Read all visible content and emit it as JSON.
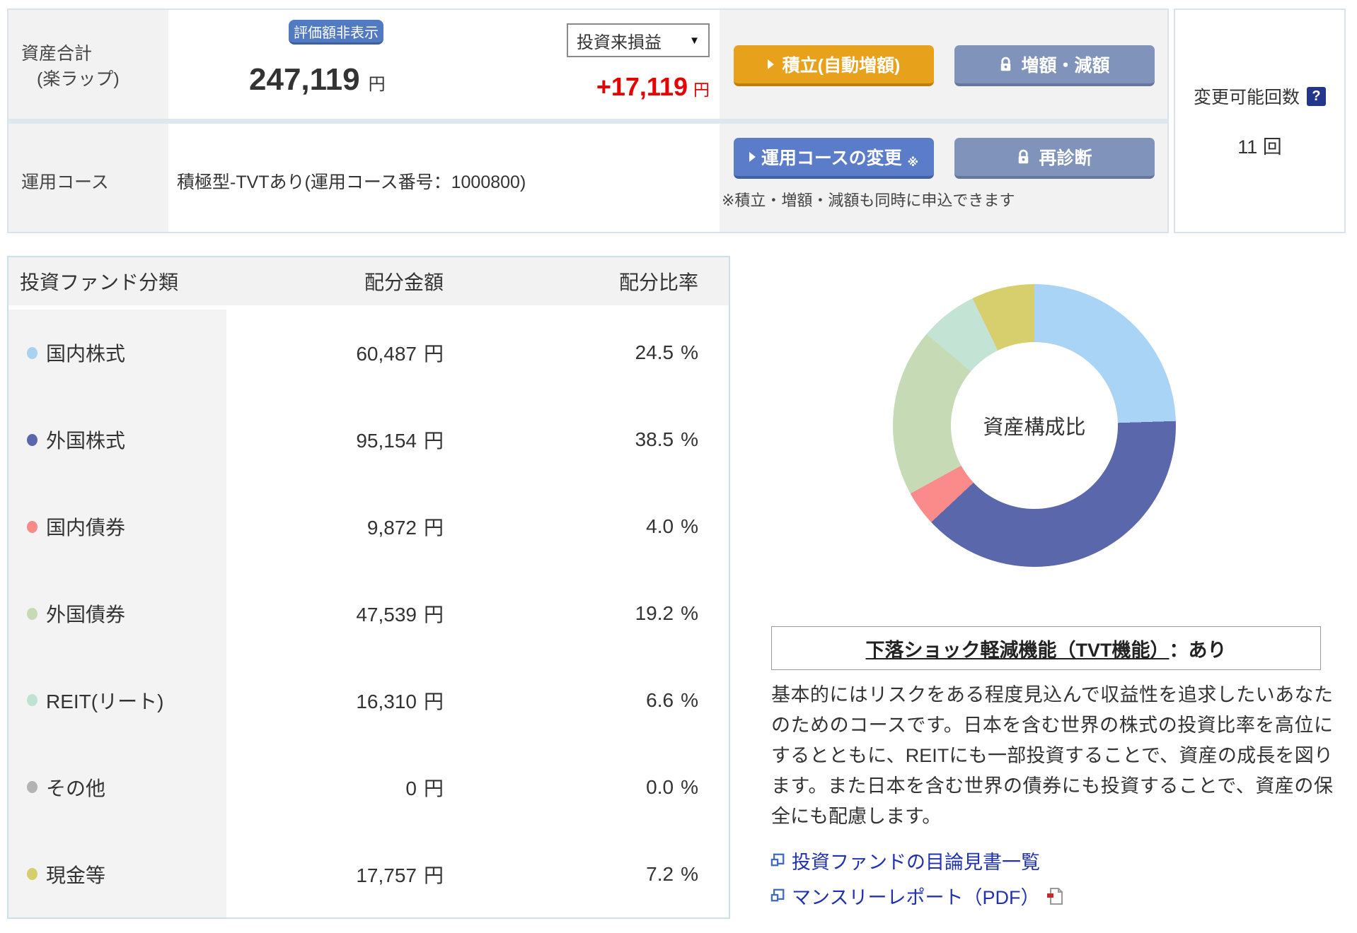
{
  "header": {
    "asset_total": {
      "label_line1": "資産合計",
      "label_line2": "(楽ラップ)",
      "hide_button": "評価額非表示",
      "amount": "247,119",
      "amount_unit": "円"
    },
    "profit": {
      "dropdown_value": "投資来損益",
      "value": "+17,119",
      "unit": "円"
    },
    "course": {
      "label": "運用コース",
      "value": "積極型-TVTあり(運用コース番号：1000800)"
    },
    "buttons": {
      "tsumitate": "積立(自動増額)",
      "zogaku_gengaku": "増額・減額",
      "course_change": "運用コースの変更",
      "course_change_mark": "※",
      "rediagnosis": "再診断"
    },
    "note": "※積立・増額・減額も同時に申込できます",
    "change_count": {
      "label": "変更可能回数",
      "help": "?",
      "value": "11",
      "unit": "回"
    }
  },
  "icons": {
    "caret_down": "▼"
  },
  "alloc_table": {
    "headers": [
      "投資ファンド分類",
      "配分金額",
      "配分比率"
    ],
    "amount_unit": "円",
    "ratio_unit": "%",
    "rows": [
      {
        "label": "国内株式",
        "color": "#a8d2f0",
        "amount": "60,487",
        "ratio": "24.5"
      },
      {
        "label": "外国株式",
        "color": "#5a67ab",
        "amount": "95,154",
        "ratio": "38.5"
      },
      {
        "label": "国内債券",
        "color": "#f88a8a",
        "amount": "9,872",
        "ratio": "4.0"
      },
      {
        "label": "外国債券",
        "color": "#c7dab6",
        "amount": "47,539",
        "ratio": "19.2"
      },
      {
        "label": "REIT(リート)",
        "color": "#bfe2d2",
        "amount": "16,310",
        "ratio": "6.6"
      },
      {
        "label": "その他",
        "color": "#b3b3b3",
        "amount": "0",
        "ratio": "0.0"
      },
      {
        "label": "現金等",
        "color": "#d6ce6c",
        "amount": "17,757",
        "ratio": "7.2"
      }
    ]
  },
  "chart_data": {
    "type": "pie",
    "title": "資産構成比",
    "categories": [
      "国内株式",
      "外国株式",
      "国内債券",
      "外国債券",
      "REIT(リート)",
      "その他",
      "現金等"
    ],
    "values": [
      24.5,
      38.5,
      4.0,
      19.2,
      6.6,
      0.0,
      7.2
    ],
    "colors": [
      "#a9d4f5",
      "#5a67ab",
      "#fb8b8b",
      "#c7dab6",
      "#c3e3d4",
      "#b3b3b3",
      "#d7cf6d"
    ],
    "unit": "%",
    "center_label": "資産構成比",
    "donut_inner_ratio": 0.59,
    "start_angle_deg": 0,
    "direction": "clockwise",
    "legend_position": "none"
  },
  "course_info": {
    "tvt_title": "下落ショック軽減機能（TVT機能）",
    "tvt_value": "：あり",
    "description": "基本的にはリスクをある程度見込んで収益性を追求したいあなたのためのコースです。日本を含む世界の株式の投資比率を高位にするとともに、REITにも一部投資することで、資産の成長を図ります。また日本を含む世界の債券にも投資することで、資産の保全にも配慮します。",
    "links": [
      {
        "label": "投資ファンドの目論見書一覧"
      },
      {
        "label": "マンスリーレポート（PDF）"
      }
    ]
  },
  "colors": {
    "accent_orange": "#e7a11b",
    "accent_blue": "#5b7cc8",
    "accent_slate": "#8093ba",
    "profit_red": "#e60000",
    "link_blue": "#2132b0",
    "panel_border": "#d9e3ea",
    "cell_gray": "#f2f2f2"
  }
}
